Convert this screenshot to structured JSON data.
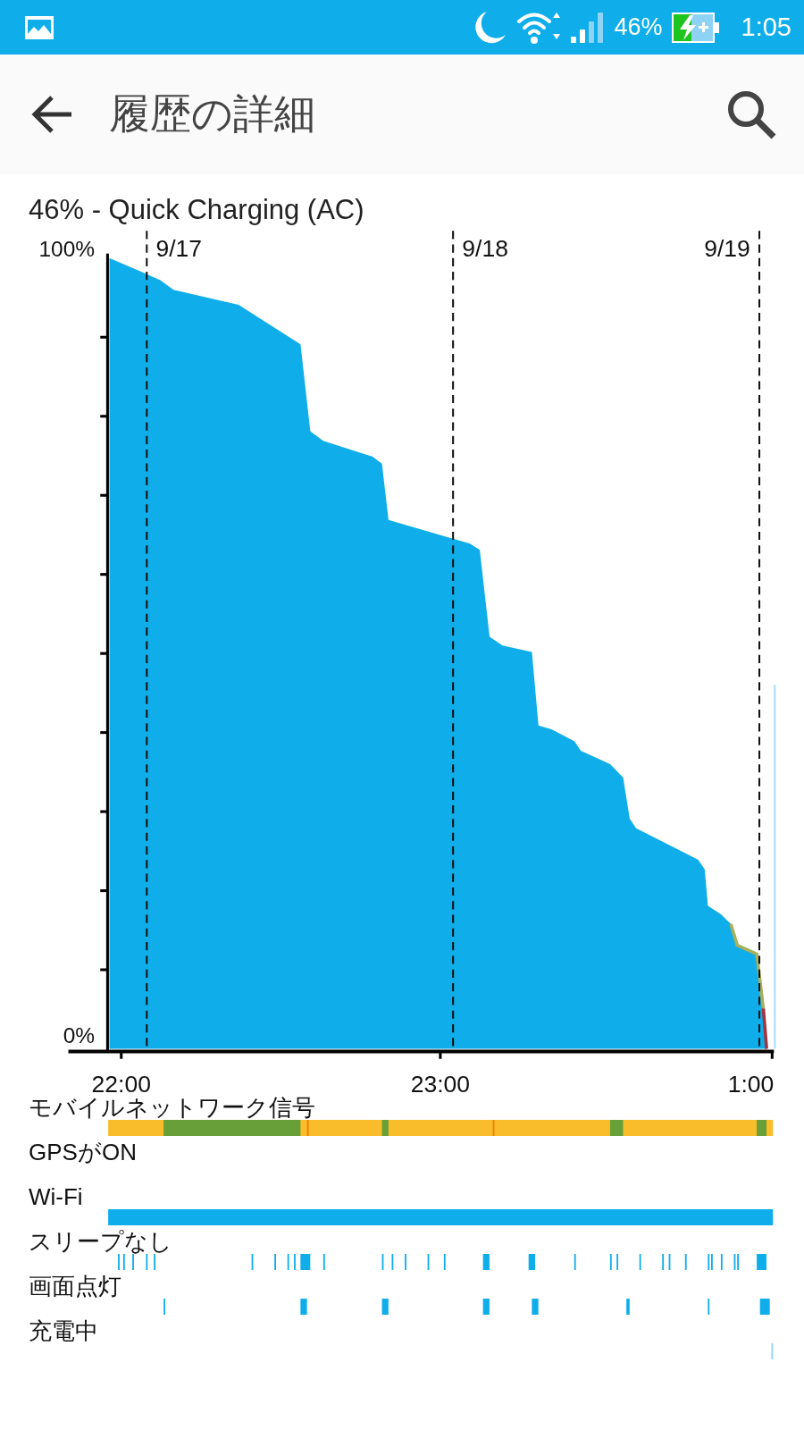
{
  "status_bar": {
    "battery_percent": "46%",
    "time": "1:05"
  },
  "toolbar": {
    "title": "履歴の詳細"
  },
  "subtitle": "46% - Quick Charging (AC)",
  "chart": {
    "y_labels": [
      "100%",
      "0%"
    ],
    "date_markers": [
      "9/17",
      "9/18",
      "9/19"
    ],
    "time_labels": [
      "22:00",
      "23:00",
      "1:00"
    ]
  },
  "activity_rows": [
    {
      "label": "モバイルネットワーク信号",
      "kind": "network"
    },
    {
      "label": "GPSがON",
      "kind": "gps"
    },
    {
      "label": "Wi-Fi",
      "kind": "wifi"
    },
    {
      "label": "スリープなし",
      "kind": "awake"
    },
    {
      "label": "画面点灯",
      "kind": "screen"
    },
    {
      "label": "充電中",
      "kind": "charging"
    }
  ]
}
